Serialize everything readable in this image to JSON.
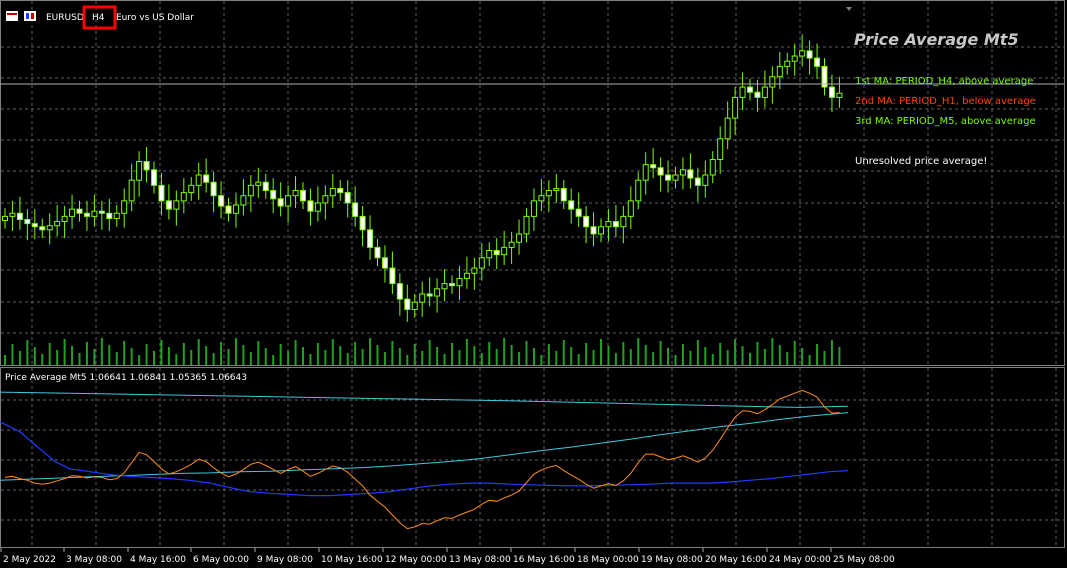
{
  "header": {
    "symbol": "EURUSD",
    "timeframe": "H4",
    "description": "Euro vs US Dollar",
    "symbol_icons": [
      "grid-icon",
      "one-click-trade-icon"
    ]
  },
  "overlay": {
    "title": "Price Average Mt5",
    "lines": [
      {
        "text": "1st MA: PERIOD_H4, above average",
        "color": "#7cfc00"
      },
      {
        "text": "2nd MA: PERIOD_H1, below average",
        "color": "#ff4500"
      },
      {
        "text": "3rd MA: PERIOD_M5, above average",
        "color": "#7cfc00"
      }
    ],
    "status": "Unresolved price average!",
    "status_color": "#ffffff"
  },
  "indicator": {
    "title": "Price Average Mt5 1.06641 1.06841 1.05365 1.06643"
  },
  "time_axis": {
    "labels": [
      "2 May 2022",
      "3 May 08:00",
      "4 May 16:00",
      "6 May 00:00",
      "9 May 08:00",
      "10 May 16:00",
      "12 May 00:00",
      "13 May 08:00",
      "16 May 16:00",
      "18 May 00:00",
      "19 May 08:00",
      "20 May 16:00",
      "24 May 00:00",
      "25 May 08:00"
    ]
  },
  "colors": {
    "background": "#000000",
    "grid": "#5f5f5f",
    "candle": "#7cfc00",
    "candle_body_bull": "#000000",
    "candle_body_bear": "#ffffff",
    "volume": "#22a022",
    "ma_fast": "#ff8c1a",
    "ma_slow": "#1e3cff",
    "ma_long": "#40c8e0",
    "highlight_box": "#ff0000"
  },
  "chart_data": {
    "type": "candlestick",
    "x_labels": [
      "2 May 2022",
      "3 May 08:00",
      "4 May 16:00",
      "6 May 00:00",
      "9 May 08:00",
      "10 May 16:00",
      "12 May 00:00",
      "13 May 08:00",
      "16 May 16:00",
      "18 May 00:00",
      "19 May 08:00",
      "20 May 16:00",
      "24 May 00:00",
      "25 May 08:00"
    ],
    "close": [
      1.0545,
      1.0548,
      1.0542,
      1.0538,
      1.0535,
      1.0532,
      1.0536,
      1.054,
      1.0545,
      1.0552,
      1.0548,
      1.0545,
      1.055,
      1.0548,
      1.0543,
      1.0548,
      1.056,
      1.058,
      1.0598,
      1.059,
      1.0575,
      1.056,
      1.0552,
      1.056,
      1.0568,
      1.0575,
      1.0585,
      1.0578,
      1.0565,
      1.0555,
      1.0548,
      1.0556,
      1.0565,
      1.0575,
      1.0578,
      1.057,
      1.0562,
      1.0555,
      1.0565,
      1.057,
      1.056,
      1.055,
      1.0558,
      1.0565,
      1.0572,
      1.0568,
      1.0558,
      1.0545,
      1.0532,
      1.0515,
      1.0505,
      1.0495,
      1.048,
      1.0465,
      1.0455,
      1.0462,
      1.047,
      1.0468,
      1.0475,
      1.048,
      1.0478,
      1.0485,
      1.049,
      1.0495,
      1.0505,
      1.0512,
      1.0508,
      1.0515,
      1.052,
      1.0528,
      1.0545,
      1.056,
      1.0565,
      1.057,
      1.0572,
      1.056,
      1.0552,
      1.0545,
      1.0535,
      1.0528,
      1.0535,
      1.054,
      1.0535,
      1.0545,
      1.056,
      1.058,
      1.0595,
      1.0592,
      1.0585,
      1.058,
      1.0585,
      1.059,
      1.0582,
      1.0575,
      1.0585,
      1.06,
      1.062,
      1.064,
      1.066,
      1.067,
      1.0665,
      1.066,
      1.067,
      1.068,
      1.069,
      1.0695,
      1.07,
      1.0705,
      1.0698,
      1.069,
      1.067,
      1.066,
      1.0664
    ],
    "ma_fast": [
      1.055,
      1.0552,
      1.0548,
      1.0545,
      1.054,
      1.0538,
      1.054,
      1.0544,
      1.0548,
      1.0553,
      1.0552,
      1.0549,
      1.0551,
      1.055,
      1.0546,
      1.0548,
      1.0558,
      1.0576,
      1.0594,
      1.059,
      1.0578,
      1.0565,
      1.0556,
      1.056,
      1.0566,
      1.0573,
      1.0582,
      1.0578,
      1.0567,
      1.0558,
      1.0551,
      1.0556,
      1.0564,
      1.0573,
      1.0577,
      1.0571,
      1.0564,
      1.0557,
      1.0564,
      1.0569,
      1.0561,
      1.0552,
      1.0557,
      1.0564,
      1.057,
      1.0567,
      1.0559,
      1.0547,
      1.0535,
      1.0519,
      1.0508,
      1.0498,
      1.0484,
      1.047,
      1.046,
      1.0463,
      1.0469,
      1.0468,
      1.0474,
      1.0479,
      1.0478,
      1.0484,
      1.0489,
      1.0494,
      1.0503,
      1.051,
      1.0508,
      1.0514,
      1.0519,
      1.0526,
      1.0541,
      1.0556,
      1.0563,
      1.0568,
      1.0571,
      1.0562,
      1.0554,
      1.0547,
      1.0538,
      1.0531,
      1.0535,
      1.0539,
      1.0536,
      1.0544,
      1.0557,
      1.0576,
      1.0591,
      1.0591,
      1.0586,
      1.0581,
      1.0584,
      1.0588,
      1.0583,
      1.0577,
      1.0584,
      1.0598,
      1.0617,
      1.0637,
      1.0656,
      1.0667,
      1.0666,
      1.0662,
      1.0669,
      1.0678,
      1.0688,
      1.0693,
      1.0698,
      1.0703,
      1.0698,
      1.0691,
      1.0674,
      1.0663,
      1.0664
    ],
    "ma_slow_points": [
      [
        0,
        1.0648
      ],
      [
        20,
        1.063
      ],
      [
        40,
        1.06
      ],
      [
        55,
        1.0578
      ],
      [
        70,
        1.0565
      ],
      [
        90,
        1.056
      ],
      [
        110,
        1.0555
      ],
      [
        130,
        1.0552
      ],
      [
        150,
        1.055
      ],
      [
        170,
        1.0548
      ],
      [
        190,
        1.0545
      ],
      [
        210,
        1.054
      ],
      [
        230,
        1.0532
      ],
      [
        250,
        1.0525
      ],
      [
        270,
        1.0522
      ],
      [
        290,
        1.052
      ],
      [
        310,
        1.0518
      ],
      [
        330,
        1.0518
      ],
      [
        350,
        1.052
      ],
      [
        370,
        1.0522
      ],
      [
        390,
        1.0525
      ],
      [
        410,
        1.053
      ],
      [
        430,
        1.0535
      ],
      [
        450,
        1.0538
      ],
      [
        470,
        1.054
      ],
      [
        490,
        1.054
      ],
      [
        510,
        1.0538
      ],
      [
        530,
        1.0537
      ],
      [
        550,
        1.0536
      ],
      [
        570,
        1.0535
      ],
      [
        590,
        1.0535
      ],
      [
        610,
        1.0536
      ],
      [
        630,
        1.0537
      ],
      [
        650,
        1.0538
      ],
      [
        670,
        1.054
      ],
      [
        690,
        1.054
      ],
      [
        710,
        1.054
      ],
      [
        730,
        1.0542
      ],
      [
        750,
        1.0545
      ],
      [
        770,
        1.0548
      ],
      [
        790,
        1.0552
      ],
      [
        810,
        1.0556
      ],
      [
        830,
        1.056
      ],
      [
        848,
        1.0562
      ]
    ],
    "ma_long_points": [
      [
        0,
        1.0545
      ],
      [
        30,
        1.0547
      ],
      [
        60,
        1.0549
      ],
      [
        90,
        1.0551
      ],
      [
        120,
        1.0553
      ],
      [
        150,
        1.0555
      ],
      [
        180,
        1.0557
      ],
      [
        210,
        1.0558
      ],
      [
        240,
        1.056
      ],
      [
        270,
        1.0561
      ],
      [
        300,
        1.0563
      ],
      [
        330,
        1.0565
      ],
      [
        360,
        1.0567
      ],
      [
        390,
        1.057
      ],
      [
        420,
        1.0574
      ],
      [
        450,
        1.0578
      ],
      [
        480,
        1.0583
      ],
      [
        510,
        1.059
      ],
      [
        540,
        1.0597
      ],
      [
        570,
        1.0603
      ],
      [
        600,
        1.061
      ],
      [
        630,
        1.0617
      ],
      [
        660,
        1.0625
      ],
      [
        690,
        1.0632
      ],
      [
        720,
        1.0639
      ],
      [
        750,
        1.0645
      ],
      [
        780,
        1.0652
      ],
      [
        810,
        1.0658
      ],
      [
        848,
        1.0664
      ]
    ],
    "ma_flat_points": [
      [
        0,
        1.07
      ],
      [
        100,
        1.0697
      ],
      [
        200,
        1.0694
      ],
      [
        300,
        1.0691
      ],
      [
        400,
        1.0688
      ],
      [
        500,
        1.0685
      ],
      [
        600,
        1.0681
      ],
      [
        700,
        1.0677
      ],
      [
        800,
        1.0673
      ],
      [
        848,
        1.0675
      ]
    ],
    "ylim": [
      1.044,
      1.073
    ]
  }
}
